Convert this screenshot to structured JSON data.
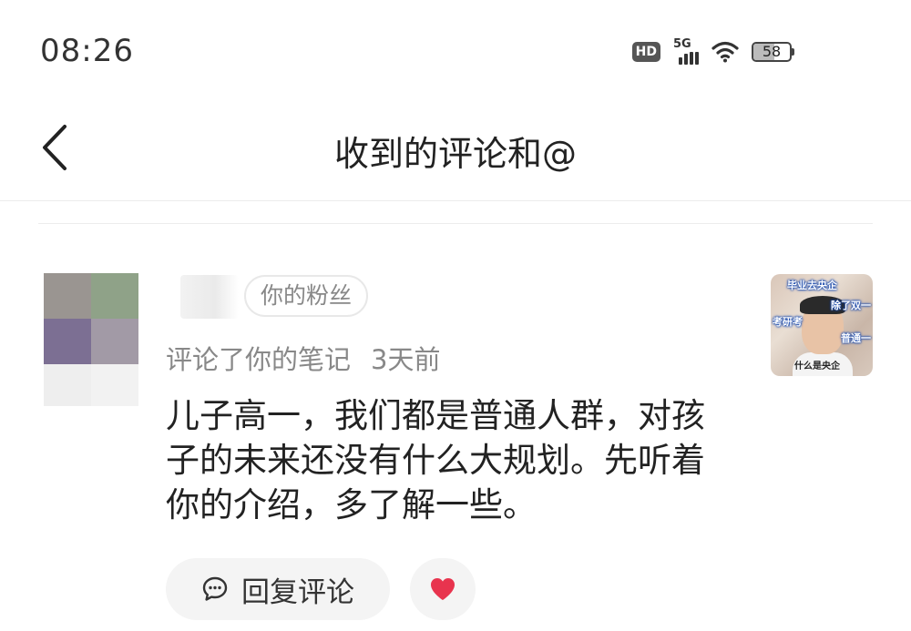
{
  "status_bar": {
    "time": "08:26",
    "hd_badge": "HD",
    "network": "5G",
    "signal_bars": 4,
    "battery_percent": 58
  },
  "nav": {
    "title": "收到的评论和@",
    "back_icon": "chevron-left-icon"
  },
  "comment": {
    "fan_tag": "你的粉丝",
    "action_text": "评论了你的笔记",
    "time_ago": "3天前",
    "text_lines": [
      "儿子高一，我们都是普通人群，对孩",
      "子的未来还没有什么大规划。先听着",
      "你的介绍，多了解一些。"
    ],
    "thumbnail_captions": [
      "毕业去央企",
      "除了双一",
      "考研考",
      "普通一",
      "什么是央企"
    ],
    "reply_label": "回复评论",
    "like_icon": "heart-icon",
    "like_color": "#e8344e"
  },
  "colors": {
    "avatar_tiles": [
      "#9a9591",
      "#8fa288",
      "#7c6f93",
      "#a29aa6",
      "#eeeeee",
      "#f2f2f2"
    ]
  }
}
